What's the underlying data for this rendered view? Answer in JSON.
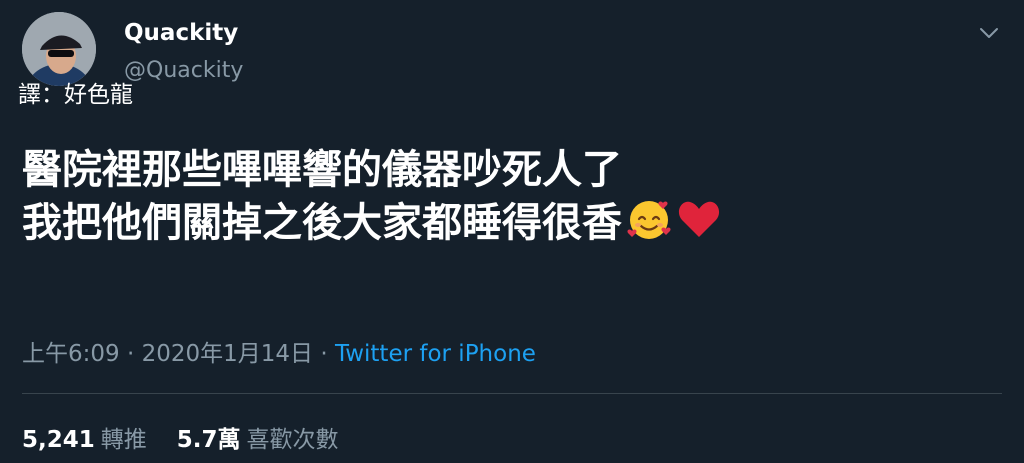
{
  "tweet": {
    "display_name": "Quackity",
    "handle": "@Quackity",
    "translator_note": "譯：好色龍",
    "text_lines": [
      "醫院裡那些嗶嗶響的儀器吵死人了",
      "我把他們關掉之後大家都睡得很香"
    ],
    "emojis": [
      "smiling-face-with-hearts",
      "red-heart"
    ],
    "time": "上午6:09",
    "date": "2020年1月14日",
    "separator": " · ",
    "source": "Twitter for iPhone",
    "retweets": {
      "count": "5,241",
      "label": "轉推"
    },
    "likes": {
      "count": "5.7萬",
      "label": "喜歡次數"
    }
  },
  "colors": {
    "background": "#15202b",
    "primary_text": "#ffffff",
    "secondary_text": "#8899a6",
    "accent": "#1da1f2",
    "divider": "#38444d"
  }
}
